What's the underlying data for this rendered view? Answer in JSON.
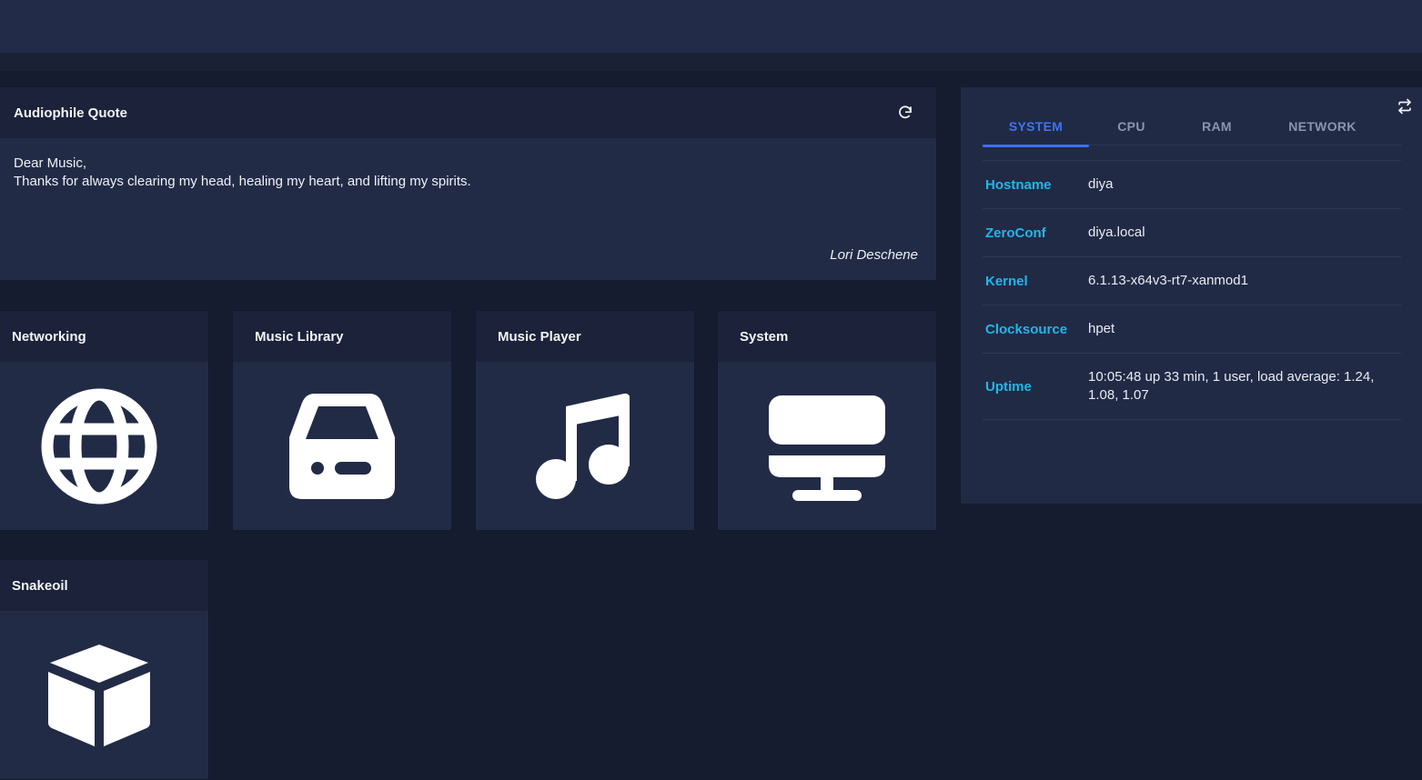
{
  "quote": {
    "title": "Audiophile Quote",
    "line1": "Dear Music,",
    "line2": "Thanks for always clearing my head, healing my heart, and lifting my spirits.",
    "author": "Lori Deschene"
  },
  "tiles": [
    {
      "label": "Networking",
      "icon": "globe-icon"
    },
    {
      "label": "Music Library",
      "icon": "hard-drive-icon"
    },
    {
      "label": "Music Player",
      "icon": "music-note-icon"
    },
    {
      "label": "System",
      "icon": "monitor-icon"
    },
    {
      "label": "Snakeoil",
      "icon": "cube-icon"
    }
  ],
  "system_info": {
    "tabs": [
      "SYSTEM",
      "CPU",
      "RAM",
      "NETWORK"
    ],
    "active_tab": "SYSTEM",
    "rows": [
      {
        "key": "Hostname",
        "value": "diya"
      },
      {
        "key": "ZeroConf",
        "value": "diya.local"
      },
      {
        "key": "Kernel",
        "value": "6.1.13-x64v3-rt7-xanmod1"
      },
      {
        "key": "Clocksource",
        "value": "hpet"
      },
      {
        "key": "Uptime",
        "value": "10:05:48 up 33 min, 1 user, load average: 1.24, 1.08, 1.07"
      }
    ]
  },
  "colors": {
    "background": "#161c30",
    "card": "#222b46",
    "accent_blue": "#3f73f0",
    "key_cyan": "#22b6e8"
  }
}
